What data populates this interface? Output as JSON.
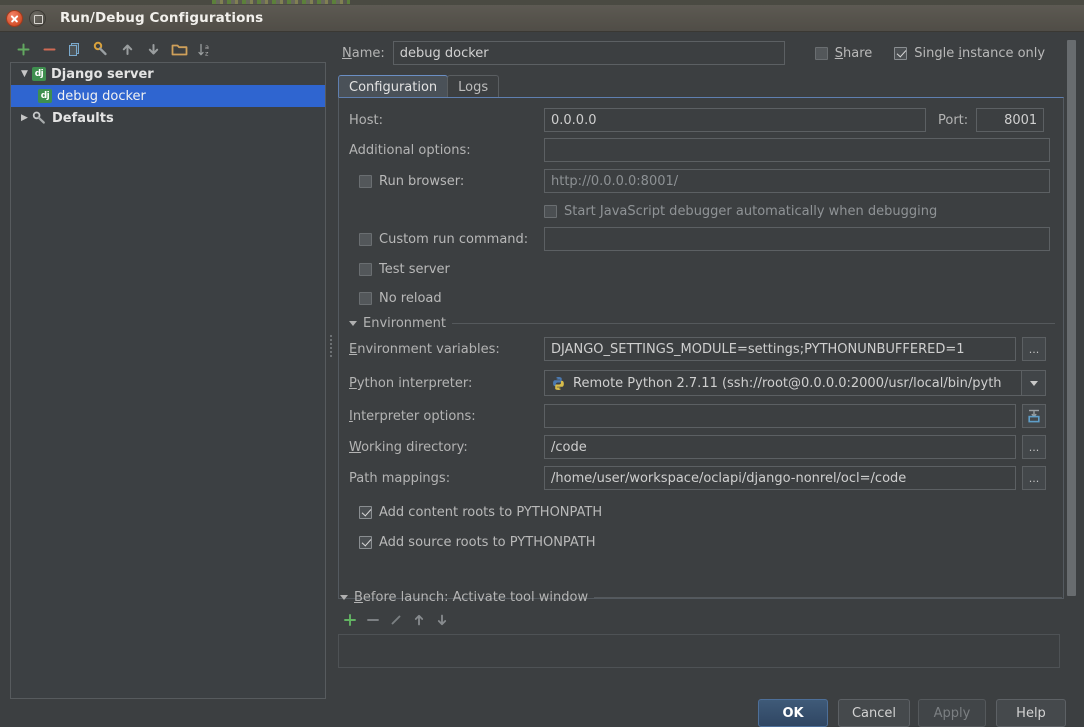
{
  "window": {
    "title": "Run/Debug Configurations",
    "close_icon": "close-icon",
    "maximize_icon": "maximize-icon"
  },
  "left_toolbar": {
    "buttons": [
      {
        "name": "add-configuration-button",
        "icon": "plus-icon",
        "glyph": "+"
      },
      {
        "name": "remove-configuration-button",
        "icon": "minus-icon",
        "glyph": "−"
      },
      {
        "name": "copy-configuration-button",
        "icon": "copy-icon",
        "glyph": "❐"
      },
      {
        "name": "edit-defaults-button",
        "icon": "wrench-icon",
        "glyph": "⚒"
      },
      {
        "name": "move-up-button",
        "icon": "arrow-up-icon",
        "glyph": "↑"
      },
      {
        "name": "move-down-button",
        "icon": "arrow-down-icon",
        "glyph": "↓"
      },
      {
        "name": "move-into-folder-button",
        "icon": "folder-icon",
        "glyph": "▭"
      },
      {
        "name": "sort-alphabetically-button",
        "icon": "sort-az-icon",
        "glyph": "↓az"
      }
    ]
  },
  "tree": {
    "items": [
      {
        "label": "Django server",
        "icon": "django-icon",
        "icon_text": "dj",
        "expanded": true,
        "selected": false,
        "bold": true,
        "indent": 0,
        "twisty": "▼"
      },
      {
        "label": "debug docker",
        "icon": "django-icon",
        "icon_text": "dj",
        "expanded": false,
        "selected": true,
        "bold": false,
        "indent": 1,
        "twisty": ""
      },
      {
        "label": "Defaults",
        "icon": "wrench-icon",
        "icon_text": "",
        "expanded": false,
        "selected": false,
        "bold": true,
        "indent": 0,
        "twisty": "▶"
      }
    ]
  },
  "form": {
    "name_label": "Name:",
    "name_value": "debug docker",
    "share_label": "Share",
    "share_checked": false,
    "single_instance_label": "Single instance only",
    "single_instance_checked": true,
    "tabs": [
      {
        "label": "Configuration",
        "active": true
      },
      {
        "label": "Logs",
        "active": false
      }
    ],
    "host_label": "Host:",
    "host_value": "0.0.0.0",
    "port_label": "Port:",
    "port_value": "8001",
    "additional_options_label": "Additional options:",
    "additional_options_value": "",
    "run_browser_label": "Run browser:",
    "run_browser_checked": false,
    "run_browser_url": "http://0.0.0.0:8001/",
    "js_debugger_label": "Start JavaScript debugger automatically when debugging",
    "js_debugger_checked": false,
    "custom_run_command_label": "Custom run command:",
    "custom_run_command_checked": false,
    "custom_run_command_value": "",
    "test_server_label": "Test server",
    "test_server_checked": false,
    "no_reload_label": "No reload",
    "no_reload_checked": false,
    "environment_section_label": "Environment",
    "env_vars_label": "Environment variables:",
    "env_vars_value": "DJANGO_SETTINGS_MODULE=settings;PYTHONUNBUFFERED=1",
    "python_interpreter_label": "Python interpreter:",
    "python_interpreter_value": "Remote Python 2.7.11 (ssh://root@0.0.0.0:2000/usr/local/bin/pyth",
    "interpreter_options_label": "Interpreter options:",
    "interpreter_options_value": "",
    "working_directory_label": "Working directory:",
    "working_directory_value": "/code",
    "path_mappings_label": "Path mappings:",
    "path_mappings_value": "/home/user/workspace/oclapi/django-nonrel/ocl=/code",
    "add_content_roots_label": "Add content roots to PYTHONPATH",
    "add_content_roots_checked": true,
    "add_source_roots_label": "Add source roots to PYTHONPATH",
    "add_source_roots_checked": true,
    "ellipsis_label": "...",
    "before_launch_label": "Before launch: Activate tool window",
    "before_launch_buttons": [
      {
        "name": "before-launch-add-button",
        "icon": "plus-icon",
        "glyph": "+"
      },
      {
        "name": "before-launch-remove-button",
        "icon": "minus-icon",
        "glyph": "−"
      },
      {
        "name": "before-launch-edit-button",
        "icon": "pencil-icon",
        "glyph": "✎"
      },
      {
        "name": "before-launch-up-button",
        "icon": "arrow-up-icon",
        "glyph": "↑"
      },
      {
        "name": "before-launch-down-button",
        "icon": "arrow-down-icon",
        "glyph": "↓"
      }
    ]
  },
  "buttons": {
    "ok": "OK",
    "cancel": "Cancel",
    "apply": "Apply",
    "help": "Help"
  },
  "colors": {
    "accent_blue": "#2f65d0",
    "tab_underline": "#6b8fc4",
    "dialog_bg": "#3c3f41",
    "tree_bg": "#3c4043",
    "add_green": "#5aa05a",
    "remove_red": "#cc6a5a"
  }
}
